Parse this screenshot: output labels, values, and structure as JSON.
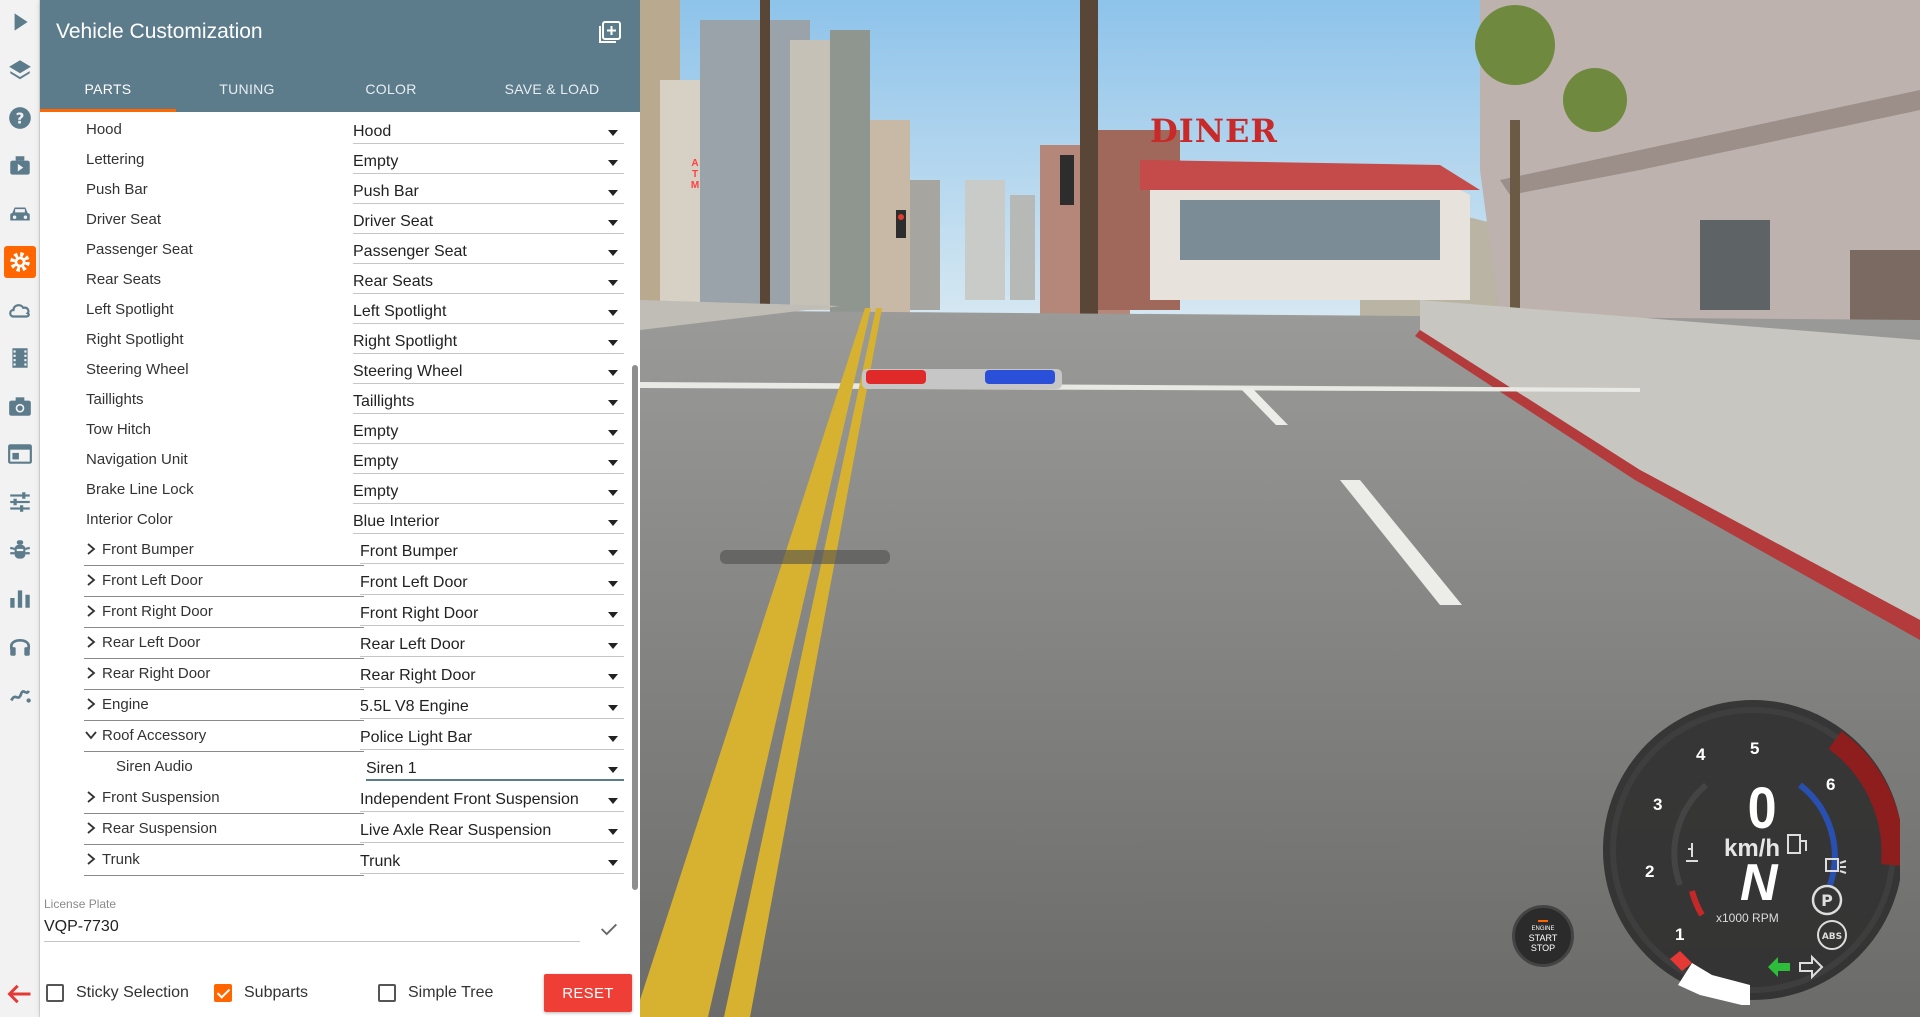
{
  "panel": {
    "title": "Vehicle Customization",
    "tabs": [
      {
        "label": "PARTS",
        "active": true
      },
      {
        "label": "TUNING"
      },
      {
        "label": "COLOR"
      },
      {
        "label": "SAVE & LOAD"
      }
    ],
    "parts": [
      {
        "label": "Hood",
        "value": "Hood"
      },
      {
        "label": "Lettering",
        "value": "Empty"
      },
      {
        "label": "Push Bar",
        "value": "Push Bar"
      },
      {
        "label": "Driver Seat",
        "value": "Driver Seat"
      },
      {
        "label": "Passenger Seat",
        "value": "Passenger Seat"
      },
      {
        "label": "Rear Seats",
        "value": "Rear Seats"
      },
      {
        "label": "Left Spotlight",
        "value": "Left Spotlight"
      },
      {
        "label": "Right Spotlight",
        "value": "Right Spotlight"
      },
      {
        "label": "Steering Wheel",
        "value": "Steering Wheel"
      },
      {
        "label": "Taillights",
        "value": "Taillights"
      },
      {
        "label": "Tow Hitch",
        "value": "Empty"
      },
      {
        "label": "Navigation Unit",
        "value": "Empty"
      },
      {
        "label": "Brake Line Lock",
        "value": "Empty"
      },
      {
        "label": "Interior Color",
        "value": "Blue Interior"
      },
      {
        "label": "Front Bumper",
        "value": "Front Bumper",
        "expandable": true
      },
      {
        "label": "Front Left Door",
        "value": "Front Left Door",
        "expandable": true
      },
      {
        "label": "Front Right Door",
        "value": "Front Right Door",
        "expandable": true
      },
      {
        "label": "Rear Left Door",
        "value": "Rear Left Door",
        "expandable": true
      },
      {
        "label": "Rear Right Door",
        "value": "Rear Right Door",
        "expandable": true
      },
      {
        "label": "Engine",
        "value": "5.5L V8 Engine",
        "expandable": true
      },
      {
        "label": "Roof Accessory",
        "value": "Police Light Bar",
        "expandable": true,
        "expanded": true
      },
      {
        "label": "Siren Audio",
        "value": "Siren 1",
        "child": true
      },
      {
        "label": "Front Suspension",
        "value": "Independent Front Suspension",
        "expandable": true
      },
      {
        "label": "Rear Suspension",
        "value": "Live Axle Rear Suspension",
        "expandable": true
      },
      {
        "label": "Trunk",
        "value": "Trunk",
        "expandable": true
      }
    ],
    "license_plate": {
      "label": "License Plate",
      "value": "VQP-7730"
    },
    "footer": {
      "sticky_selection": {
        "label": "Sticky Selection",
        "checked": false
      },
      "subparts": {
        "label": "Subparts",
        "checked": true
      },
      "simple_tree": {
        "label": "Simple Tree",
        "checked": false
      },
      "reset_label": "RESET"
    }
  },
  "rail": {
    "icons": [
      "play-icon",
      "layers-icon",
      "help-icon",
      "scenario-icon",
      "vehicle-icon",
      "customization-gear-icon",
      "environment-cloud-icon",
      "replay-film-icon",
      "camera-icon",
      "app-layout-icon",
      "options-sliders-icon",
      "debug-bug-icon",
      "performance-chart-icon",
      "audio-headphones-icon",
      "modding-icon"
    ],
    "active": "customization-gear-icon"
  },
  "scene": {
    "diner_sign": "DINER",
    "atm_sign": "ATM"
  },
  "hud": {
    "speed": "0",
    "speed_unit": "km/h",
    "gear": "N",
    "rpm_unit": "x1000 RPM",
    "rpm_ticks": [
      "1",
      "2",
      "3",
      "4",
      "5",
      "6"
    ],
    "engine_button": {
      "top": "ENGINE",
      "mid": "START",
      "bottom": "STOP"
    },
    "abs_label": "ABS",
    "park_label": "P"
  },
  "colors": {
    "header": "#5c7c8c",
    "accent": "#ff6600",
    "reset": "#ef3e36"
  }
}
